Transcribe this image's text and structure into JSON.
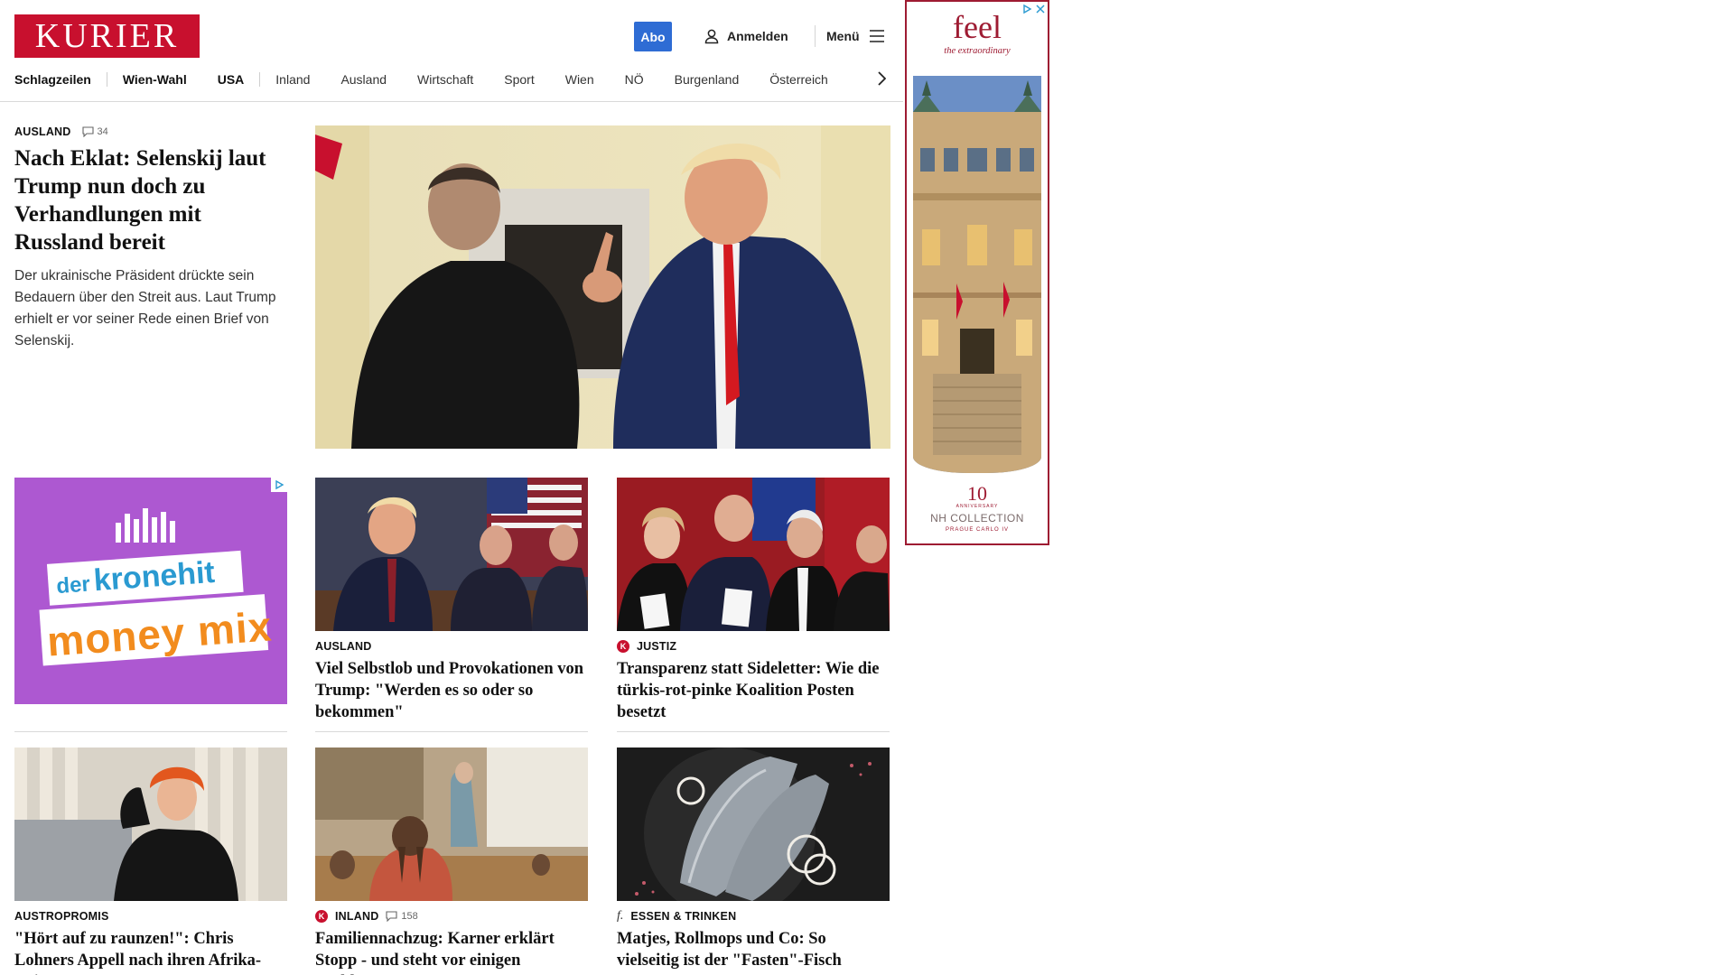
{
  "header": {
    "logo_text": "KURIER",
    "abo_label": "Abo",
    "login_label": "Anmelden",
    "menu_label": "Menü"
  },
  "nav": {
    "items": [
      "Schlagzeilen",
      "Wien-Wahl",
      "USA",
      "Inland",
      "Ausland",
      "Wirtschaft",
      "Sport",
      "Wien",
      "NÖ",
      "Burgenland",
      "Österreich"
    ]
  },
  "lead": {
    "category": "AUSLAND",
    "comments": "34",
    "title": "Nach Eklat: Selenskij laut Trump nun doch zu Verhandlungen mit Russland bereit",
    "teaser": "Der ukrainische Präsident drückte sein Bedauern über den Streit aus. Laut Trump erhielt er vor seiner Rede einen Brief von Selenskij."
  },
  "ad_square": {
    "brand_left": "der",
    "brand_right": "kronehit",
    "tagline": "money mix"
  },
  "cards": [
    {
      "category": "AUSLAND",
      "title": "Viel Selbstlob und Provokationen von Trump: \"Werden es so oder so bekommen\""
    },
    {
      "category": "JUSTIZ",
      "badge": "K",
      "title": "Transparenz statt Sideletter: Wie die türkis-rot-pinke Koalition Posten besetzt"
    },
    {
      "category": "AUSTROPROMIS",
      "title": "\"Hört auf zu raunzen!\": Chris Lohners Appell nach ihren Afrika-Reisen"
    },
    {
      "category": "INLAND",
      "badge": "K",
      "comments": "158",
      "title": "Familiennachzug: Karner erklärt Stopp - und steht vor einigen Problemen"
    },
    {
      "category": "ESSEN & TRINKEN",
      "badge": "f.",
      "title": "Matjes, Rollmops und Co: So vielseitig ist der \"Fasten\"-Fisch"
    }
  ],
  "sky_ad": {
    "headline": "feel",
    "subline": "the extraordinary",
    "number": "10",
    "anniversary": "ANNIVERSARY",
    "collection": "NH COLLECTION",
    "location": "PRAGUE CARLO IV"
  },
  "colors": {
    "brand_red": "#c8102e",
    "abo_blue": "#2e6cd4",
    "ad_purple": "#ad58d1",
    "sky_red": "#9e1b32"
  }
}
